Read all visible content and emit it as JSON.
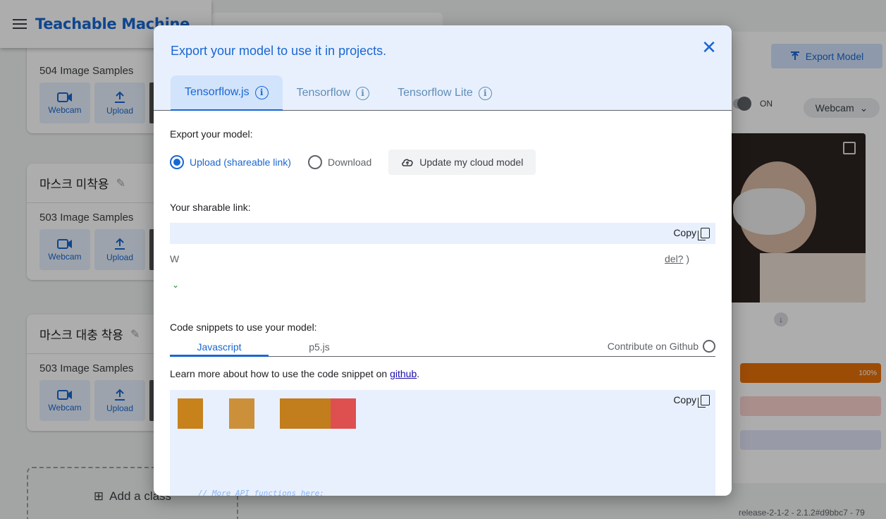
{
  "app": {
    "brand": "Teachable Machine"
  },
  "background": {
    "classes": [
      {
        "name": "",
        "samples": "504 Image Samples"
      },
      {
        "name": "마스크 미착용",
        "samples": "503 Image Samples"
      },
      {
        "name": "마스크 대충 착용",
        "samples": "503 Image Samples"
      }
    ],
    "webcam_label": "Webcam",
    "upload_label": "Upload",
    "export_model": "Export Model",
    "toggle_state": "ON",
    "camera_select": "Webcam",
    "top_bar_value": "100%",
    "add_class": "Add a class",
    "release": "release-2-1-2 - 2.1.2#d9bbc7 - 79"
  },
  "modal": {
    "title": "Export your model to use it in projects.",
    "tabs": [
      {
        "label": "Tensorflow.js",
        "active": true
      },
      {
        "label": "Tensorflow",
        "active": false
      },
      {
        "label": "Tensorflow Lite",
        "active": false
      }
    ],
    "export_label": "Export your model:",
    "options": {
      "upload": "Upload (shareable link)",
      "download": "Download",
      "cloud": "Update my cloud model"
    },
    "link_label": "Your sharable link:",
    "copy": "Copy",
    "help_start": "W",
    "help_link": "del?",
    "help_end": " )",
    "snippets_label": "Code snippets to use your model:",
    "snippet_tabs": [
      "Javascript",
      "p5.js"
    ],
    "contribute": "Contribute on Github",
    "learn_prefix": "Learn more about how to use the code snippet on ",
    "learn_link": "github",
    "learn_suffix": ".",
    "code_comment": "// More API functions here:"
  },
  "colors": {
    "accent": "#1967d2",
    "orange": "#e8710a"
  }
}
